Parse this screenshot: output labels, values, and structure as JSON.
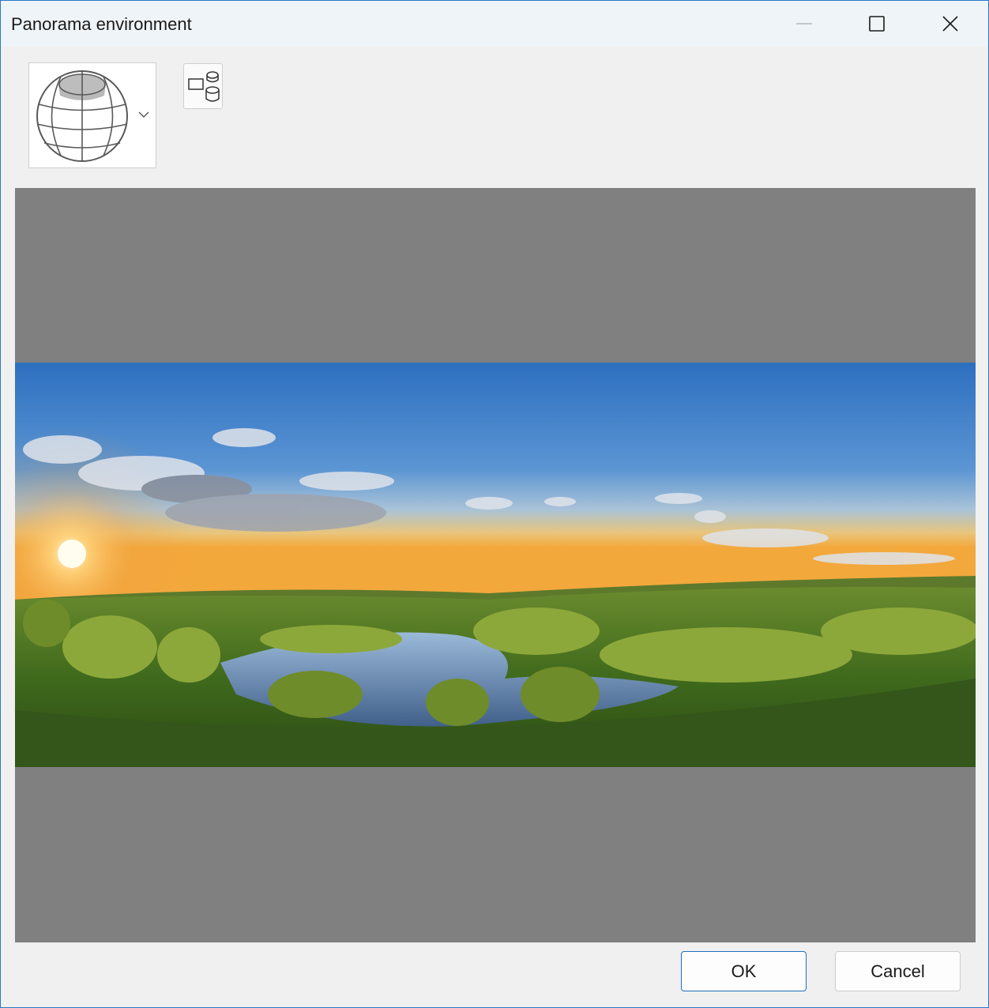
{
  "window": {
    "title": "Panorama environment",
    "accent_color": "#2b78c4",
    "controls": {
      "minimize_icon": "minimize-icon",
      "maximize_icon": "maximize-icon",
      "close_icon": "close-icon"
    }
  },
  "toolbar": {
    "projection_dropdown": {
      "icon": "spherical-globe-icon",
      "expand_icon": "chevron-down-icon"
    },
    "mapping_button": {
      "icon": "object-mapping-icon"
    }
  },
  "preview": {
    "background_color": "#808080",
    "content": "panorama-landscape-image"
  },
  "footer": {
    "ok_label": "OK",
    "cancel_label": "Cancel"
  }
}
